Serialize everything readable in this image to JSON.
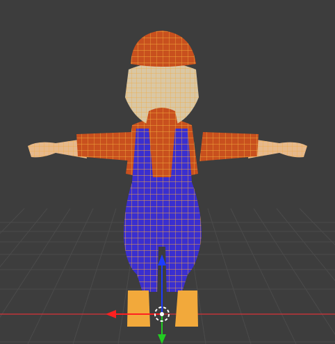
{
  "viewport": {
    "background": "#3d3d3d",
    "grid_color": "#4a4a4a",
    "x_axis_color": "#c0353a",
    "y_axis_color": "#7fbf3f",
    "wire_color": "#f2a93b"
  },
  "model": {
    "overalls_color": "#3a2fd0",
    "shirt_color": "#c8501e",
    "skin_color": "#e6b98c",
    "boot_color": "#f2a93b"
  },
  "gizmo": {
    "z_color": "#1d3cff",
    "y_color": "#22cc22",
    "x_color": "#ff2020"
  }
}
